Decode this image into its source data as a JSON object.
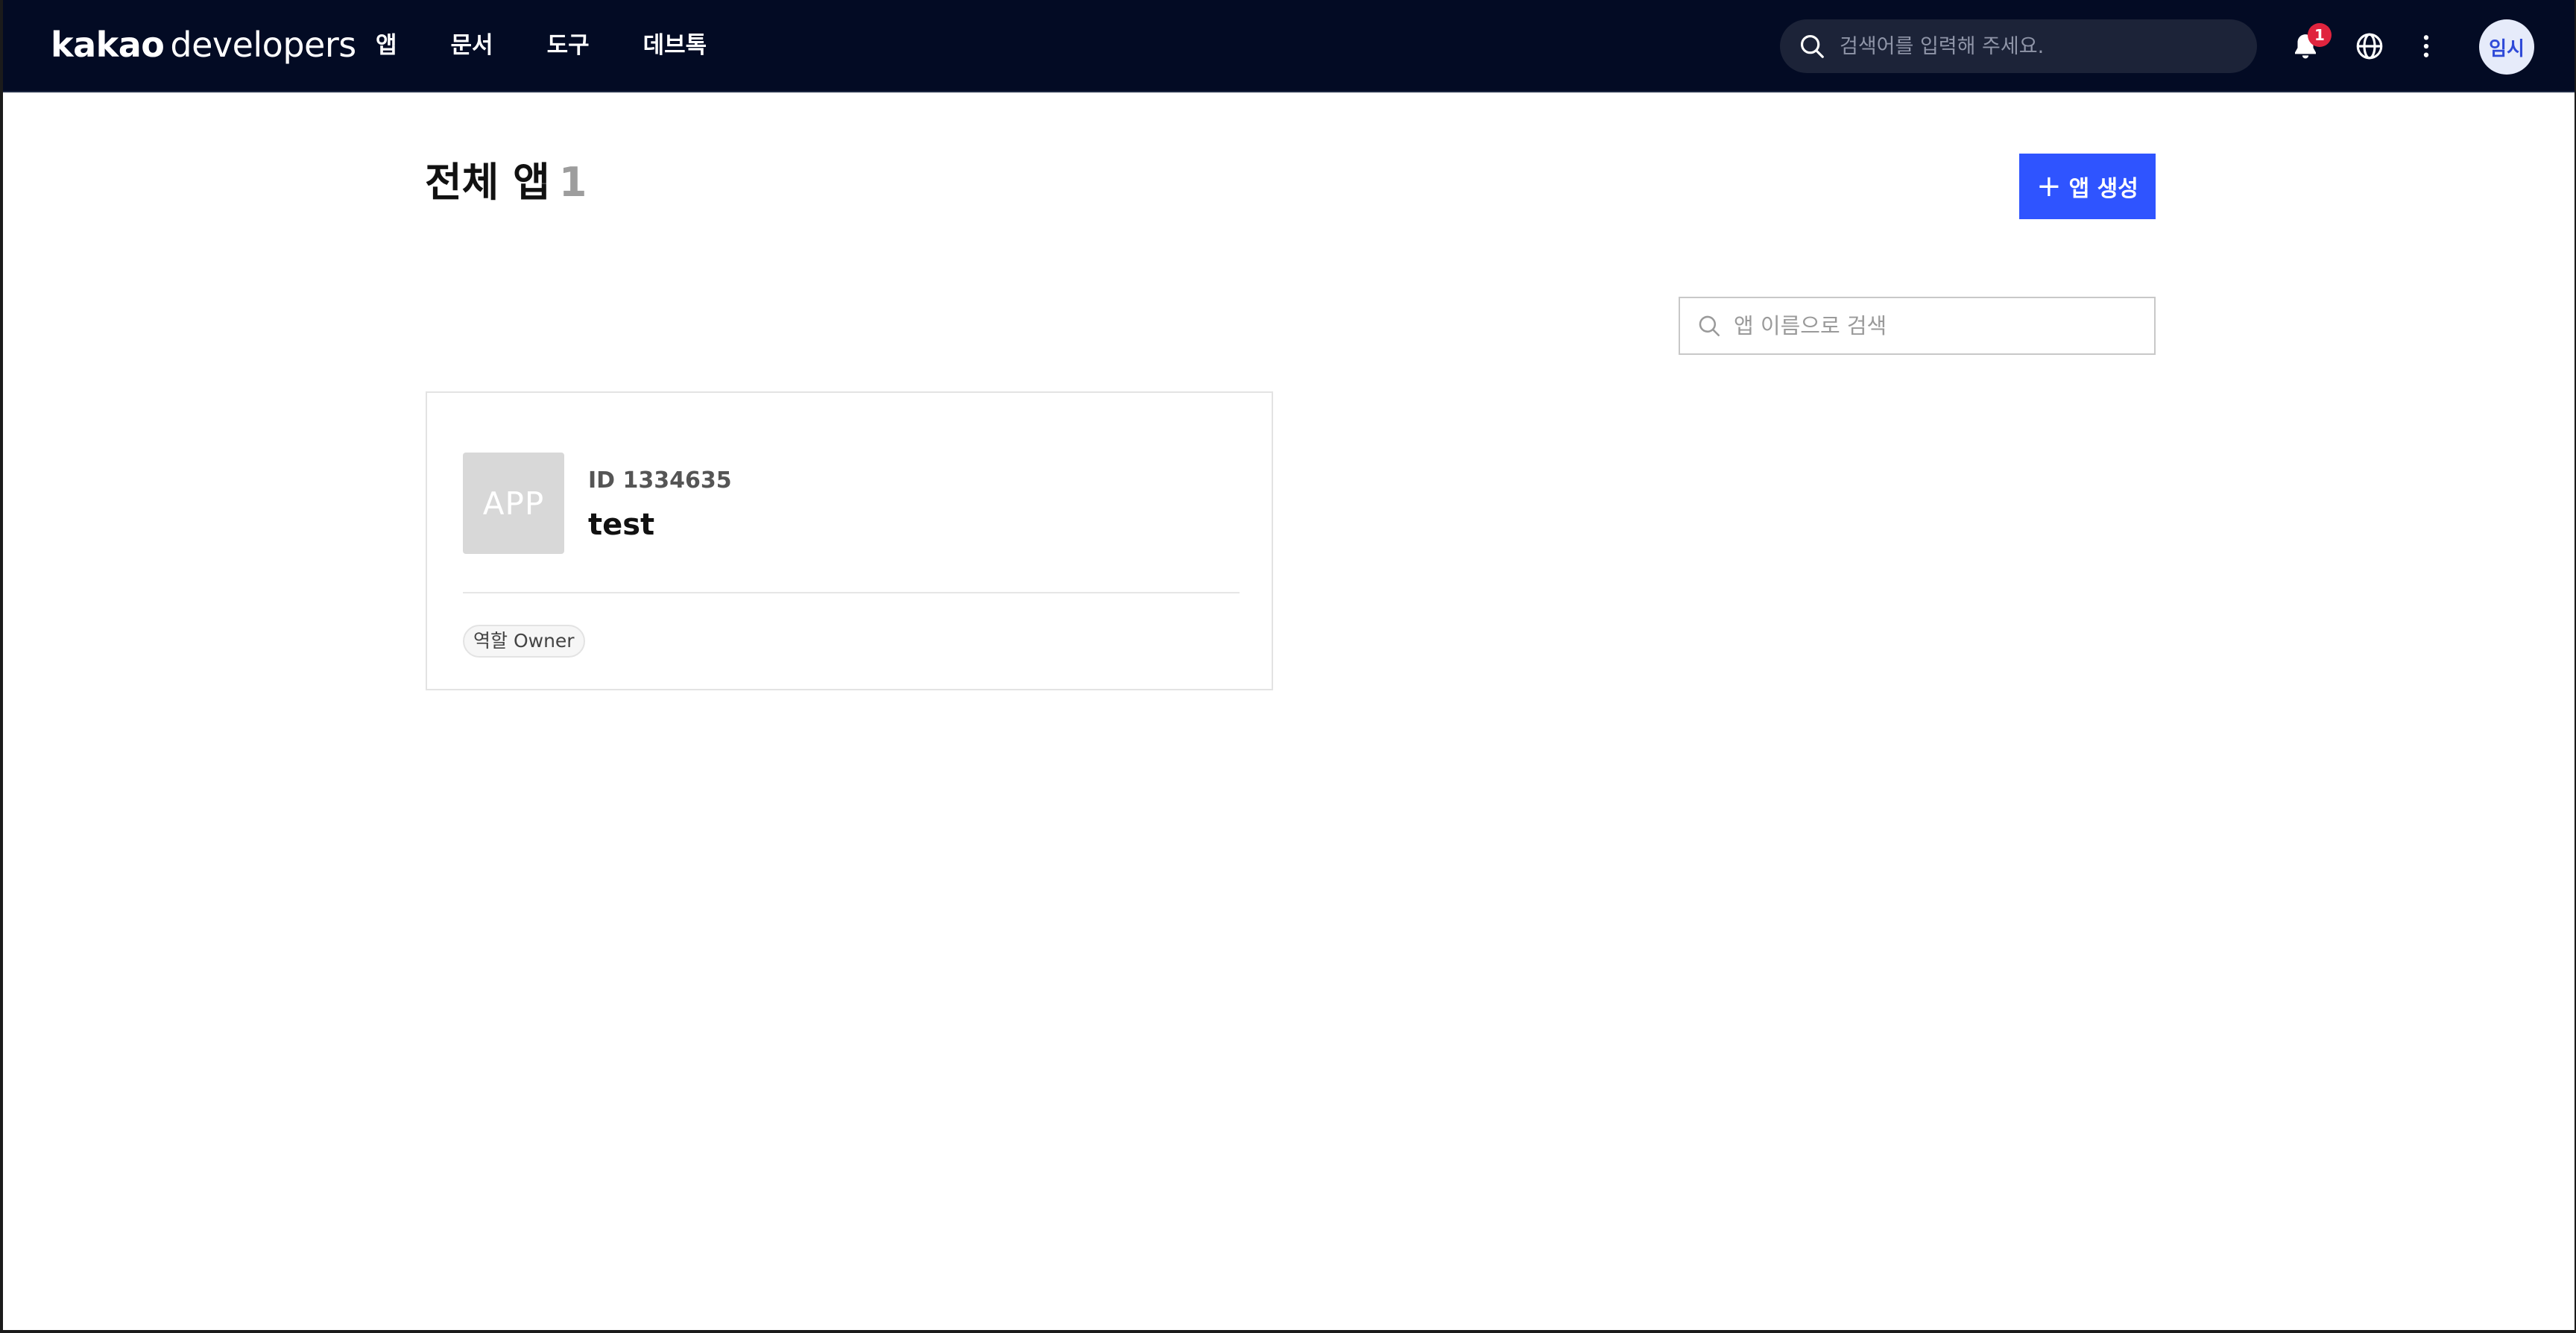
{
  "header": {
    "logo_bold": "kakao",
    "logo_light": "developers",
    "nav": [
      {
        "label": "앱"
      },
      {
        "label": "문서"
      },
      {
        "label": "도구"
      },
      {
        "label": "데브톡"
      }
    ],
    "search_placeholder": "검색어를 입력해 주세요.",
    "notification_count": "1",
    "avatar_label": "임시",
    "icons": [
      "search-icon",
      "bell-icon",
      "globe-icon",
      "more-vertical-icon"
    ]
  },
  "main": {
    "title": "전체 앱",
    "app_count": "1",
    "create_button_plus": "+",
    "create_button_label": "앱 생성",
    "app_search_placeholder": "앱 이름으로 검색",
    "apps": [
      {
        "thumbnail_text": "APP",
        "id_text": "ID 1334635",
        "name": "test",
        "role": "역할 Owner"
      }
    ]
  },
  "colors": {
    "header_bg": "#030b24",
    "accent": "#2f54ff",
    "badge": "#e0243e"
  }
}
